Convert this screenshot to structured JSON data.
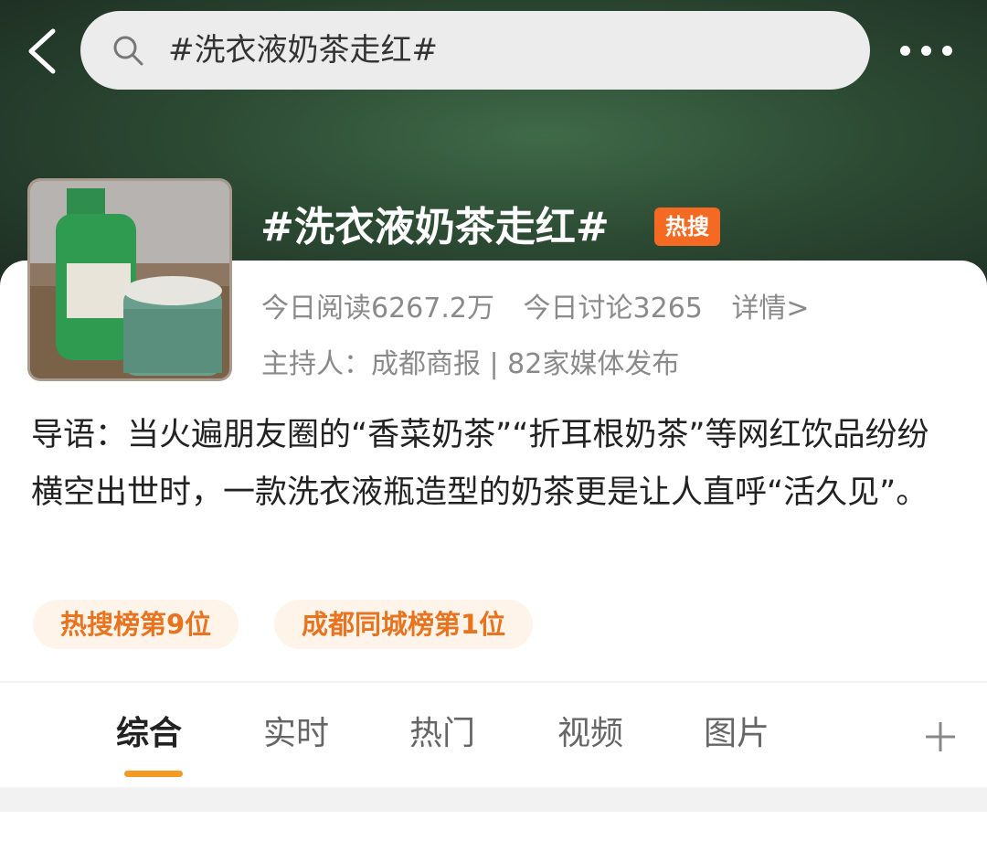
{
  "header": {
    "search_text": "#洗衣液奶茶走红#"
  },
  "topic": {
    "title": "#洗衣液奶茶走红#",
    "badge": "热搜",
    "stats": {
      "today_reads": "今日阅读6267.2万",
      "today_discussions": "今日讨论3265",
      "details": "详情>"
    },
    "host_line": "主持人：成都商报 | 82家媒体发布",
    "intro": "导语：当火遍朋友圈的“香菜奶茶”“折耳根奶茶”等网红饮品纷纷横空出世时，一款洗衣液瓶造型的奶茶更是让人直呼“活久见”。",
    "ranks": [
      "热搜榜第9位",
      "成都同城榜第1位"
    ]
  },
  "tabs": [
    "综合",
    "实时",
    "热门",
    "视频",
    "图片"
  ],
  "colors": {
    "accent": "#f56a23",
    "rank_text": "#e8741f",
    "tab_underline": "#f29a25"
  },
  "icons": [
    "back-arrow-icon",
    "search-icon",
    "more-icon",
    "plus-icon"
  ]
}
